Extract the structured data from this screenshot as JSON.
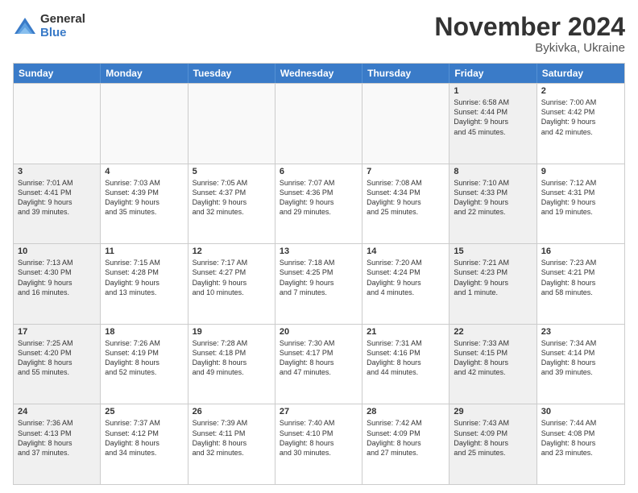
{
  "logo": {
    "general": "General",
    "blue": "Blue"
  },
  "title": {
    "month": "November 2024",
    "location": "Bykivka, Ukraine"
  },
  "header_days": [
    "Sunday",
    "Monday",
    "Tuesday",
    "Wednesday",
    "Thursday",
    "Friday",
    "Saturday"
  ],
  "rows": [
    [
      {
        "num": "",
        "info": "",
        "empty": true
      },
      {
        "num": "",
        "info": "",
        "empty": true
      },
      {
        "num": "",
        "info": "",
        "empty": true
      },
      {
        "num": "",
        "info": "",
        "empty": true
      },
      {
        "num": "",
        "info": "",
        "empty": true
      },
      {
        "num": "1",
        "info": "Sunrise: 6:58 AM\nSunset: 4:44 PM\nDaylight: 9 hours\nand 45 minutes.",
        "shaded": true
      },
      {
        "num": "2",
        "info": "Sunrise: 7:00 AM\nSunset: 4:42 PM\nDaylight: 9 hours\nand 42 minutes.",
        "shaded": false
      }
    ],
    [
      {
        "num": "3",
        "info": "Sunrise: 7:01 AM\nSunset: 4:41 PM\nDaylight: 9 hours\nand 39 minutes.",
        "shaded": true
      },
      {
        "num": "4",
        "info": "Sunrise: 7:03 AM\nSunset: 4:39 PM\nDaylight: 9 hours\nand 35 minutes."
      },
      {
        "num": "5",
        "info": "Sunrise: 7:05 AM\nSunset: 4:37 PM\nDaylight: 9 hours\nand 32 minutes."
      },
      {
        "num": "6",
        "info": "Sunrise: 7:07 AM\nSunset: 4:36 PM\nDaylight: 9 hours\nand 29 minutes."
      },
      {
        "num": "7",
        "info": "Sunrise: 7:08 AM\nSunset: 4:34 PM\nDaylight: 9 hours\nand 25 minutes."
      },
      {
        "num": "8",
        "info": "Sunrise: 7:10 AM\nSunset: 4:33 PM\nDaylight: 9 hours\nand 22 minutes.",
        "shaded": true
      },
      {
        "num": "9",
        "info": "Sunrise: 7:12 AM\nSunset: 4:31 PM\nDaylight: 9 hours\nand 19 minutes."
      }
    ],
    [
      {
        "num": "10",
        "info": "Sunrise: 7:13 AM\nSunset: 4:30 PM\nDaylight: 9 hours\nand 16 minutes.",
        "shaded": true
      },
      {
        "num": "11",
        "info": "Sunrise: 7:15 AM\nSunset: 4:28 PM\nDaylight: 9 hours\nand 13 minutes."
      },
      {
        "num": "12",
        "info": "Sunrise: 7:17 AM\nSunset: 4:27 PM\nDaylight: 9 hours\nand 10 minutes."
      },
      {
        "num": "13",
        "info": "Sunrise: 7:18 AM\nSunset: 4:25 PM\nDaylight: 9 hours\nand 7 minutes."
      },
      {
        "num": "14",
        "info": "Sunrise: 7:20 AM\nSunset: 4:24 PM\nDaylight: 9 hours\nand 4 minutes."
      },
      {
        "num": "15",
        "info": "Sunrise: 7:21 AM\nSunset: 4:23 PM\nDaylight: 9 hours\nand 1 minute.",
        "shaded": true
      },
      {
        "num": "16",
        "info": "Sunrise: 7:23 AM\nSunset: 4:21 PM\nDaylight: 8 hours\nand 58 minutes."
      }
    ],
    [
      {
        "num": "17",
        "info": "Sunrise: 7:25 AM\nSunset: 4:20 PM\nDaylight: 8 hours\nand 55 minutes.",
        "shaded": true
      },
      {
        "num": "18",
        "info": "Sunrise: 7:26 AM\nSunset: 4:19 PM\nDaylight: 8 hours\nand 52 minutes."
      },
      {
        "num": "19",
        "info": "Sunrise: 7:28 AM\nSunset: 4:18 PM\nDaylight: 8 hours\nand 49 minutes."
      },
      {
        "num": "20",
        "info": "Sunrise: 7:30 AM\nSunset: 4:17 PM\nDaylight: 8 hours\nand 47 minutes."
      },
      {
        "num": "21",
        "info": "Sunrise: 7:31 AM\nSunset: 4:16 PM\nDaylight: 8 hours\nand 44 minutes."
      },
      {
        "num": "22",
        "info": "Sunrise: 7:33 AM\nSunset: 4:15 PM\nDaylight: 8 hours\nand 42 minutes.",
        "shaded": true
      },
      {
        "num": "23",
        "info": "Sunrise: 7:34 AM\nSunset: 4:14 PM\nDaylight: 8 hours\nand 39 minutes."
      }
    ],
    [
      {
        "num": "24",
        "info": "Sunrise: 7:36 AM\nSunset: 4:13 PM\nDaylight: 8 hours\nand 37 minutes.",
        "shaded": true
      },
      {
        "num": "25",
        "info": "Sunrise: 7:37 AM\nSunset: 4:12 PM\nDaylight: 8 hours\nand 34 minutes."
      },
      {
        "num": "26",
        "info": "Sunrise: 7:39 AM\nSunset: 4:11 PM\nDaylight: 8 hours\nand 32 minutes."
      },
      {
        "num": "27",
        "info": "Sunrise: 7:40 AM\nSunset: 4:10 PM\nDaylight: 8 hours\nand 30 minutes."
      },
      {
        "num": "28",
        "info": "Sunrise: 7:42 AM\nSunset: 4:09 PM\nDaylight: 8 hours\nand 27 minutes."
      },
      {
        "num": "29",
        "info": "Sunrise: 7:43 AM\nSunset: 4:09 PM\nDaylight: 8 hours\nand 25 minutes.",
        "shaded": true
      },
      {
        "num": "30",
        "info": "Sunrise: 7:44 AM\nSunset: 4:08 PM\nDaylight: 8 hours\nand 23 minutes."
      }
    ]
  ]
}
